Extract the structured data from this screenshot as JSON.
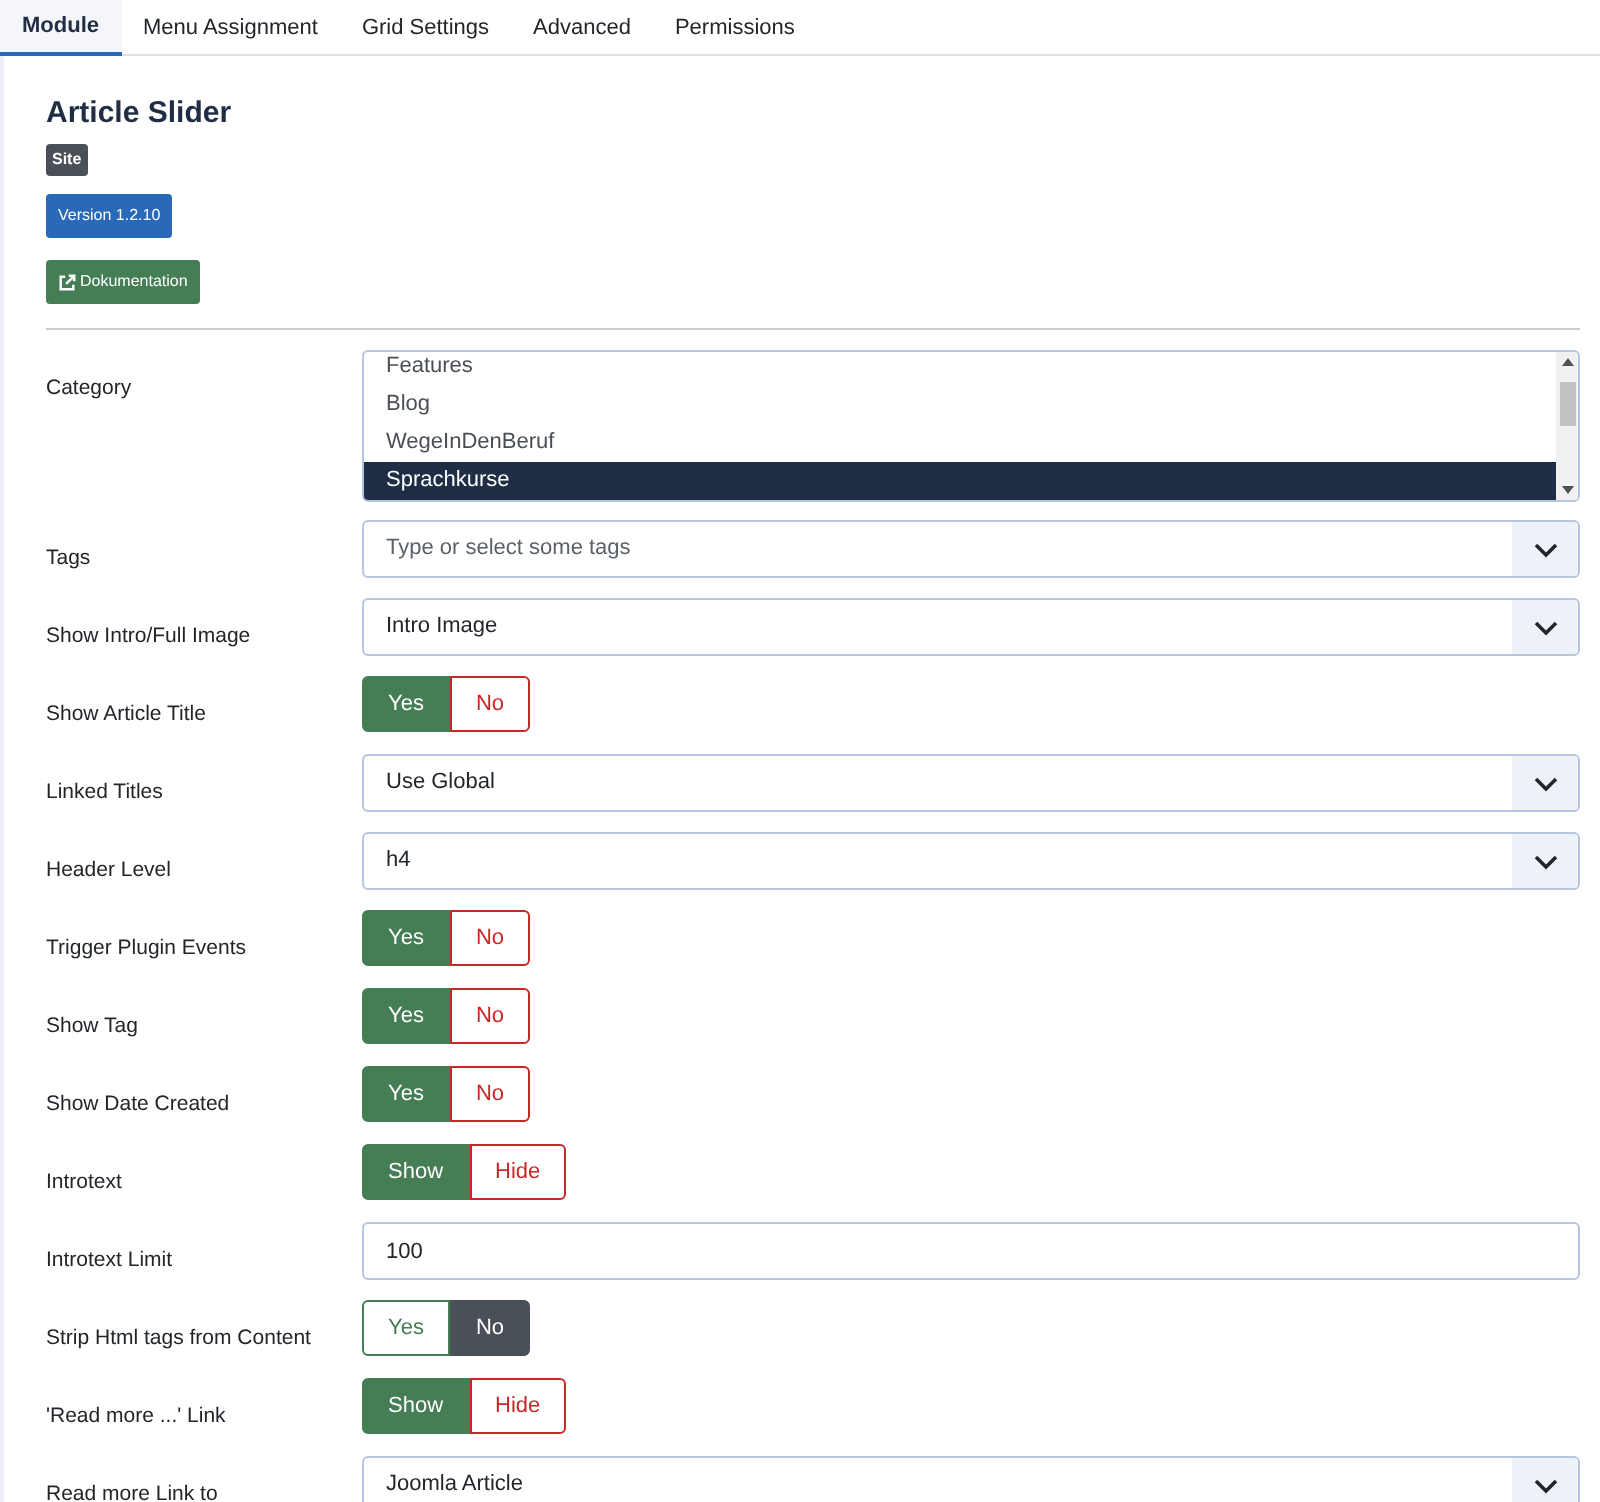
{
  "tabs": [
    {
      "label": "Module",
      "selected": true
    },
    {
      "label": "Menu Assignment",
      "selected": false
    },
    {
      "label": "Grid Settings",
      "selected": false
    },
    {
      "label": "Advanced",
      "selected": false
    },
    {
      "label": "Permissions",
      "selected": false
    }
  ],
  "module": {
    "title": "Article Slider",
    "site_badge": "Site",
    "version_badge": "Version 1.2.10",
    "docs_button": "Dokumentation"
  },
  "fields": [
    {
      "kind": "listbox",
      "label": "Category",
      "options": [
        {
          "label": "Features",
          "selected": false
        },
        {
          "label": "Blog",
          "selected": false
        },
        {
          "label": "WegeInDenBeruf",
          "selected": false
        },
        {
          "label": "Sprachkurse",
          "selected": true
        }
      ]
    },
    {
      "kind": "select",
      "label": "Tags",
      "placeholder": "Type or select some tags"
    },
    {
      "kind": "select",
      "label": "Show Intro/Full Image",
      "value": "Intro Image"
    },
    {
      "kind": "toggle",
      "label": "Show Article Title",
      "options": [
        {
          "label": "Yes",
          "selected": true
        },
        {
          "label": "No",
          "selected": false
        }
      ]
    },
    {
      "kind": "select",
      "label": "Linked Titles",
      "value": "Use Global"
    },
    {
      "kind": "select",
      "label": "Header Level",
      "value": "h4"
    },
    {
      "kind": "toggle",
      "label": "Trigger Plugin Events",
      "options": [
        {
          "label": "Yes",
          "selected": true
        },
        {
          "label": "No",
          "selected": false
        }
      ]
    },
    {
      "kind": "toggle",
      "label": "Show Tag",
      "options": [
        {
          "label": "Yes",
          "selected": true
        },
        {
          "label": "No",
          "selected": false
        }
      ]
    },
    {
      "kind": "toggle",
      "label": "Show Date Created",
      "options": [
        {
          "label": "Yes",
          "selected": true
        },
        {
          "label": "No",
          "selected": false
        }
      ]
    },
    {
      "kind": "toggle",
      "label": "Introtext",
      "options": [
        {
          "label": "Show",
          "selected": true
        },
        {
          "label": "Hide",
          "selected": false
        }
      ]
    },
    {
      "kind": "text",
      "label": "Introtext Limit",
      "value": "100"
    },
    {
      "kind": "toggle",
      "label": "Strip Html tags from Content",
      "options": [
        {
          "label": "Yes",
          "selected": false
        },
        {
          "label": "No",
          "selected": true
        }
      ]
    },
    {
      "kind": "toggle",
      "label": "'Read more ...' Link",
      "options": [
        {
          "label": "Show",
          "selected": true
        },
        {
          "label": "Hide",
          "selected": false
        }
      ]
    },
    {
      "kind": "select",
      "label": "Read more Link to",
      "value": "Joomla Article"
    }
  ]
}
